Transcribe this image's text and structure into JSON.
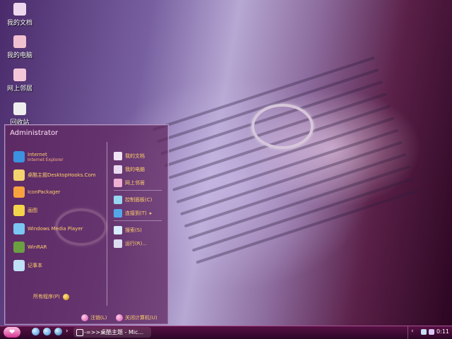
{
  "desktop": {
    "icons": [
      {
        "label": "我的文档",
        "icon": "folder-icon",
        "color": "#ecd7ee"
      },
      {
        "label": "我的电脑",
        "icon": "computer-icon",
        "color": "#f0c0d0"
      },
      {
        "label": "网上邻居",
        "icon": "network-icon",
        "color": "#f4c6d8"
      },
      {
        "label": "回收站",
        "icon": "trash-icon",
        "color": "#eeeeee"
      }
    ]
  },
  "start_menu": {
    "user": "Administrator",
    "left_items": [
      {
        "label": "Internet",
        "sublabel": "Internet Explorer",
        "icon": "internet-icon",
        "color": "#3c92e0"
      },
      {
        "label": "桌酷主题DesktopHooks.Com",
        "icon": "theme-icon",
        "color": "#f4d36f"
      },
      {
        "label": "IconPackager",
        "icon": "iconpackager-icon",
        "color": "#f6a23f"
      },
      {
        "label": "画图",
        "icon": "paint-icon",
        "color": "#f3d44a"
      },
      {
        "label": "Windows Media Player",
        "icon": "media-player-icon",
        "color": "#79c7f2"
      },
      {
        "label": "WinRAR",
        "icon": "winrar-icon",
        "color": "#6b9f42"
      },
      {
        "label": "记事本",
        "icon": "notepad-icon",
        "color": "#bfe0f5"
      }
    ],
    "all_programs": "所有程序(P)",
    "right_items": [
      {
        "label": "我的文档",
        "icon": "folder-icon",
        "color": "#f0e4f4"
      },
      {
        "label": "我的电脑",
        "icon": "computer-icon",
        "color": "#ead9f1"
      },
      {
        "label": "网上邻居",
        "icon": "network-icon",
        "color": "#efb1d2"
      },
      {
        "label": "控制面板(C)",
        "icon": "control-panel-icon",
        "color": "#97d6f1"
      },
      {
        "label": "连接到(T)",
        "icon": "connect-icon",
        "color": "#54a6e7"
      },
      {
        "label": "搜索(S)",
        "icon": "search-icon",
        "color": "#d7ecff"
      },
      {
        "label": "运行(R)...",
        "icon": "run-icon",
        "color": "#dcdcf2"
      }
    ],
    "logoff": "注销(L)",
    "shutdown": "关闭计算机(U)"
  },
  "taskbar": {
    "start_glyph": "❤",
    "task_label": "-=>>桌酷主题 - Mic...",
    "clock": "0:11"
  }
}
